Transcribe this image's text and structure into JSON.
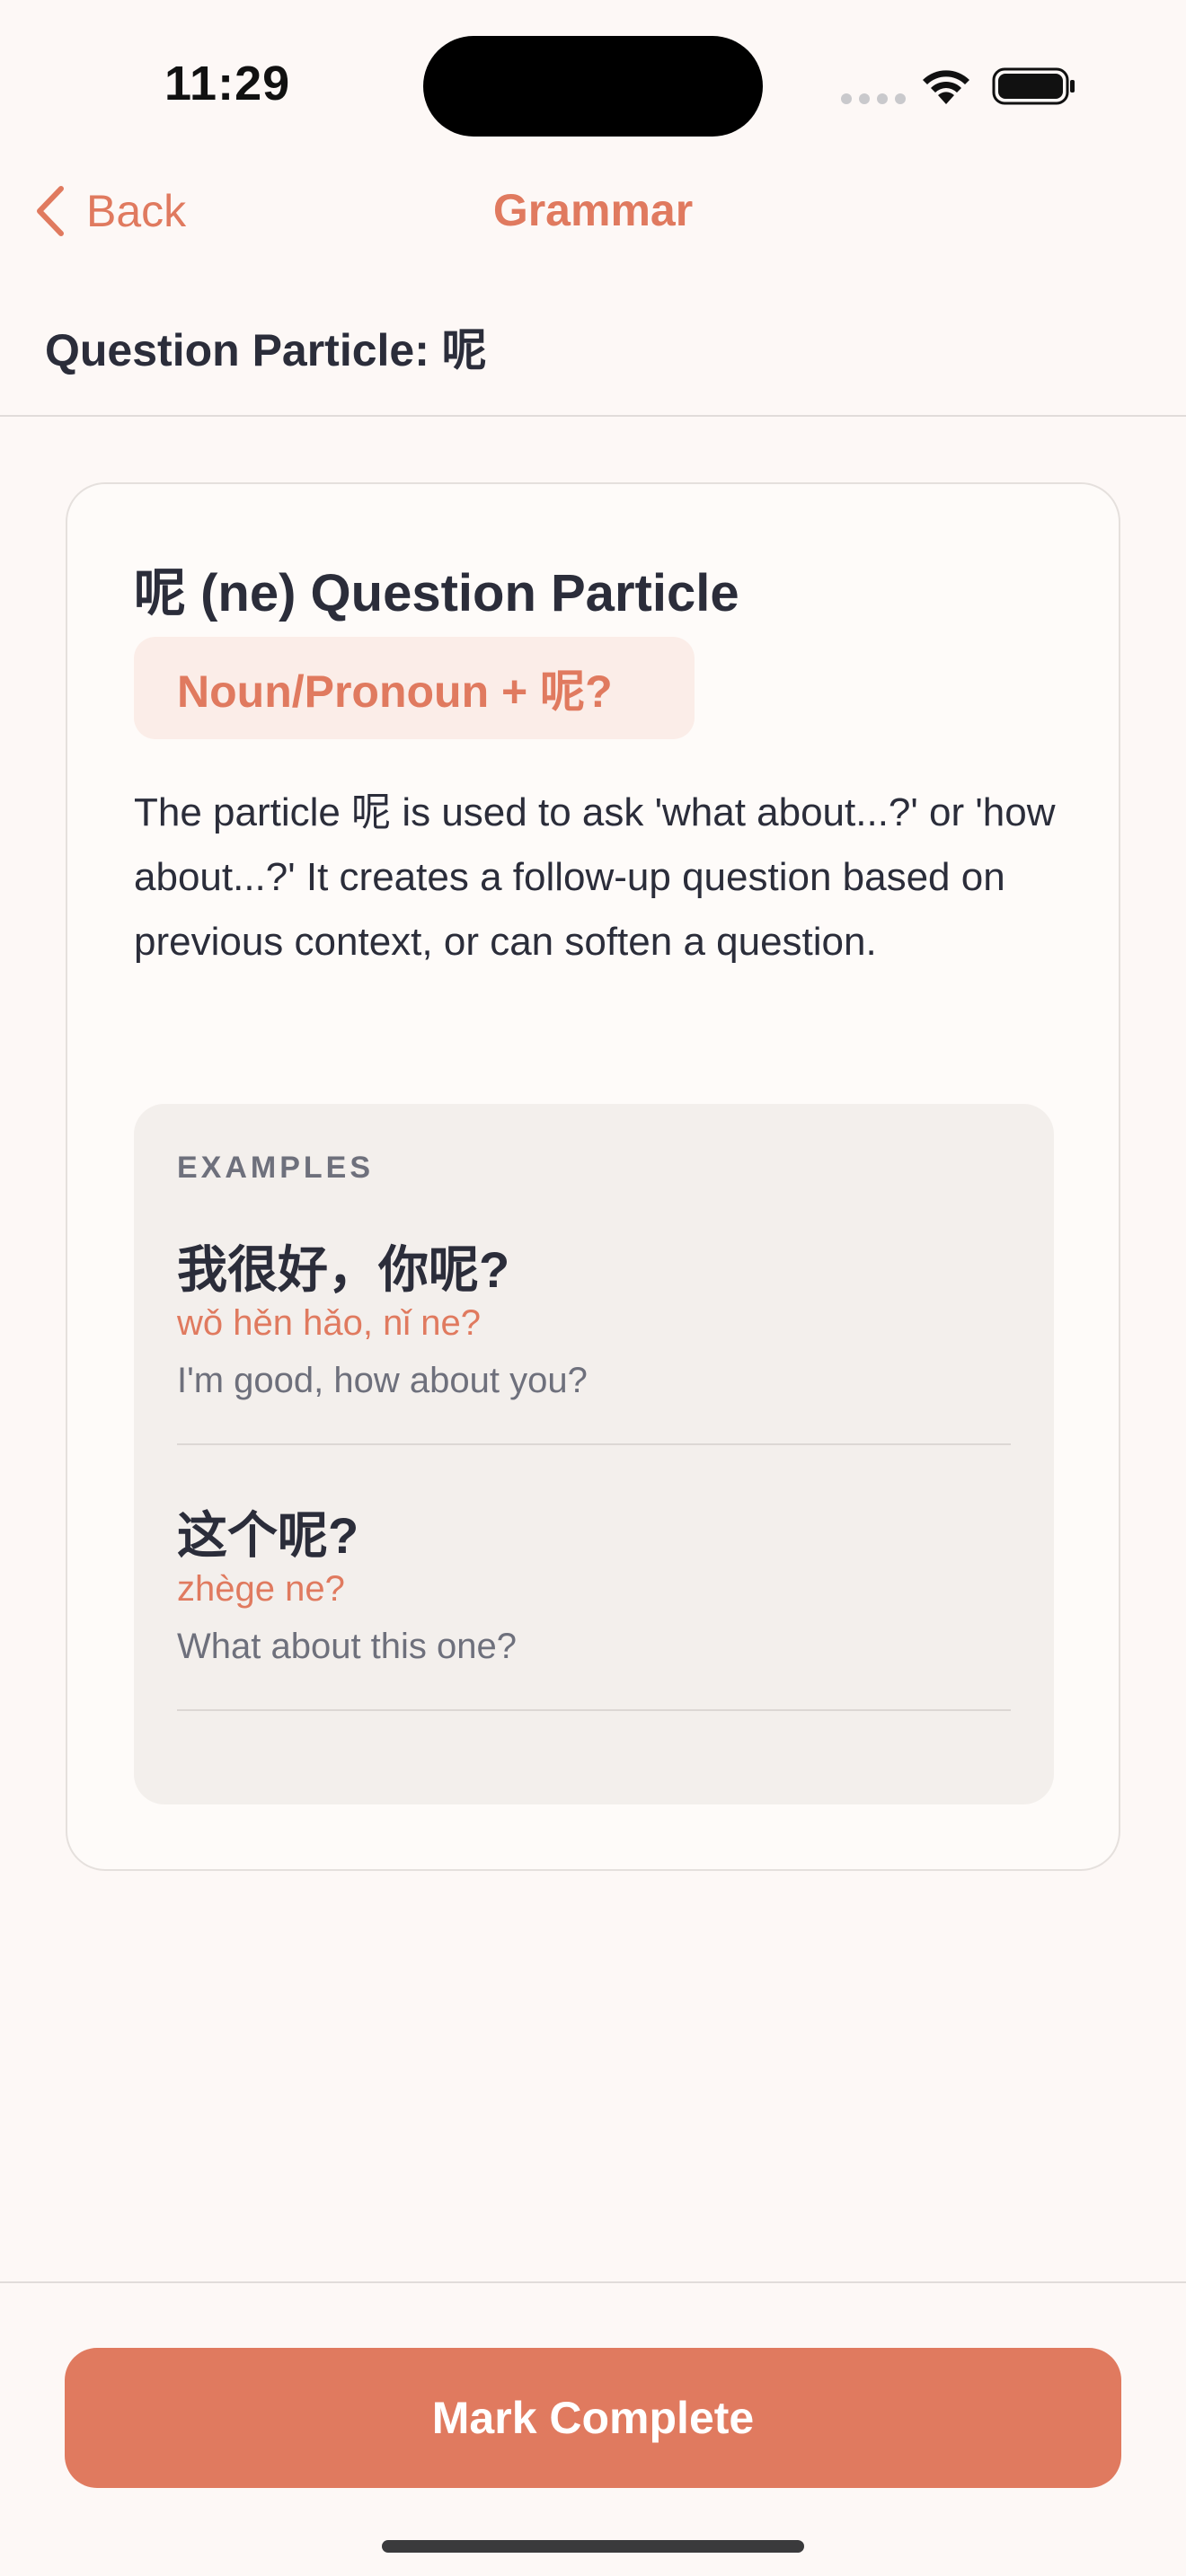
{
  "status_bar": {
    "time": "11:29"
  },
  "nav": {
    "back_label": "Back",
    "title": "Grammar",
    "accent_color": "#E07A5F"
  },
  "page": {
    "title": "Question Particle: 呢"
  },
  "card": {
    "title": "呢 (ne) Question Particle",
    "pattern": "Noun/Pronoun + 呢?",
    "description": "The particle 呢 is used to ask 'what about...?' or 'how about...?' It creates a follow-up question based on previous context, or can soften a question.",
    "examples_label": "EXAMPLES",
    "examples": [
      {
        "chinese": "我很好，你呢?",
        "pinyin": "wǒ hěn hǎo, nǐ ne?",
        "english": "I'm good, how about you?"
      },
      {
        "chinese": "这个呢?",
        "pinyin": "zhège ne?",
        "english": "What about this one?"
      }
    ]
  },
  "footer": {
    "button_label": "Mark Complete"
  },
  "icons": {
    "back": "chevron-left-icon",
    "wifi": "wifi-icon",
    "battery": "battery-icon",
    "signal": "signal-dots-icon"
  }
}
